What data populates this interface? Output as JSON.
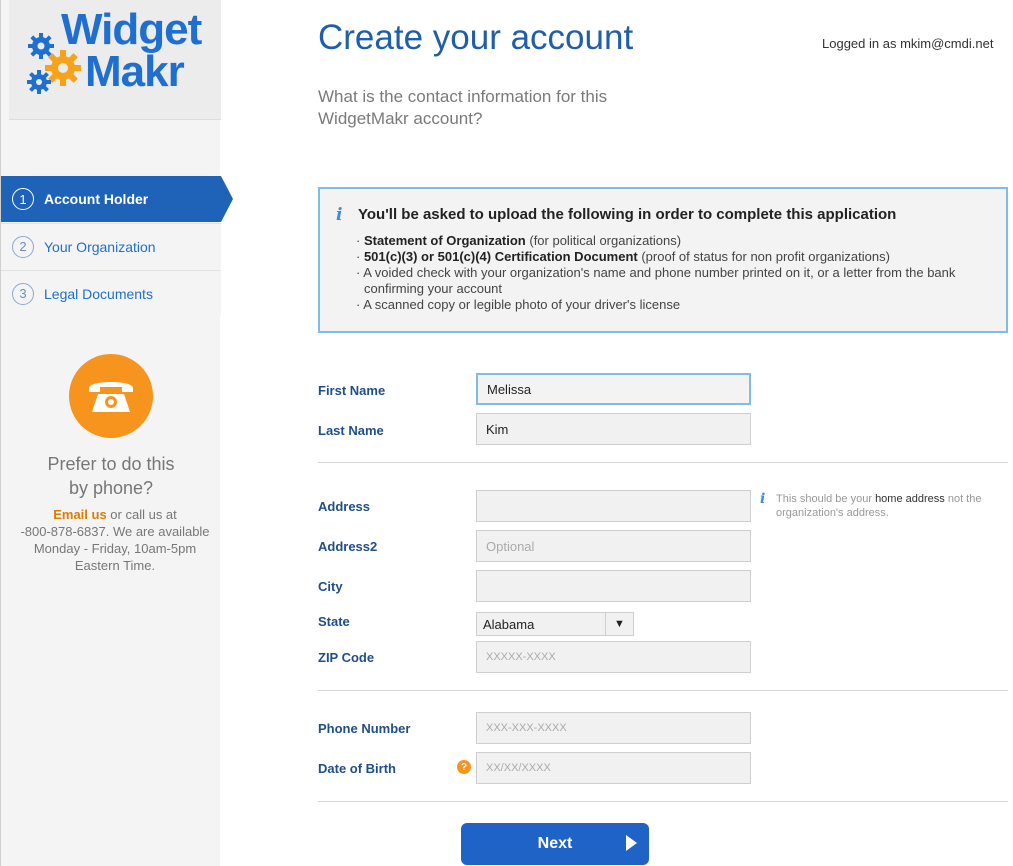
{
  "brand": {
    "line1": "Widget",
    "line2": "Makr",
    "color": "#1f6fd1"
  },
  "sidebar": {
    "steps": [
      {
        "num": "1",
        "label": "Account Holder",
        "active": true
      },
      {
        "num": "2",
        "label": "Your Organization",
        "active": false
      },
      {
        "num": "3",
        "label": "Legal Documents",
        "active": false
      }
    ],
    "phone_prompt_line1": "Prefer to do this",
    "phone_prompt_line2": "by phone?",
    "email_link": "Email us",
    "contact_line1_rest": " or call us at",
    "contact_line2": "-800-878-6837. We are available",
    "contact_line3": "Monday - Friday, 10am-5pm",
    "contact_line4": "Eastern Time."
  },
  "header": {
    "title": "Create your account",
    "logged_in": "Logged in as mkim@cmdi.net",
    "subtitle": "What is the contact information for this WidgetMakr account?"
  },
  "info": {
    "icon": "i",
    "heading": "You'll be asked to upload the following in order to complete this application",
    "items": [
      {
        "bold": "Statement of Organization",
        "rest": " (for political organizations)"
      },
      {
        "bold": "501(c)(3) or 501(c)(4) Certification Document",
        "rest": " (proof of status for non profit organizations)"
      },
      {
        "bold": "",
        "rest": "A voided check with your organization's name and phone number printed on it, or a letter from the bank confirming your account"
      },
      {
        "bold": "",
        "rest": "A scanned copy or legible photo of your driver's license"
      }
    ]
  },
  "form": {
    "first_name": {
      "label": "First Name",
      "value": "Melissa"
    },
    "last_name": {
      "label": "Last Name",
      "value": "Kim"
    },
    "address": {
      "label": "Address",
      "value": ""
    },
    "address2": {
      "label": "Address2",
      "placeholder": "Optional"
    },
    "city": {
      "label": "City",
      "value": ""
    },
    "state": {
      "label": "State",
      "value": "Alabama"
    },
    "zip": {
      "label": "ZIP Code",
      "placeholder": "XXXXX-XXXX"
    },
    "phone": {
      "label": "Phone Number",
      "placeholder": "XXX-XXX-XXXX"
    },
    "dob": {
      "label": "Date of Birth",
      "placeholder": "XX/XX/XXXX"
    },
    "address_hint_1": "This should be your ",
    "address_hint_strong": "home address",
    "address_hint_2": " not the organization's address.",
    "help_badge": "?"
  },
  "actions": {
    "next_label": "Next"
  },
  "colors": {
    "accent": "#1f63b8",
    "orange": "#f7941d",
    "info_border": "#7fbde8"
  }
}
